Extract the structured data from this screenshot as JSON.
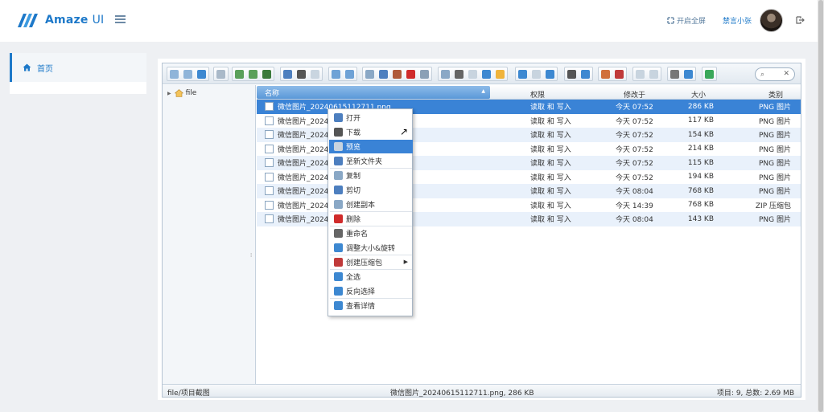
{
  "app": {
    "name": "Amaze",
    "name_suffix": "UI"
  },
  "header": {
    "fullscreen_label": "开启全屏",
    "username": "禁言小张"
  },
  "sidebar": {
    "items": [
      {
        "label": "首页"
      }
    ]
  },
  "filemanager": {
    "tree_root": "file",
    "columns": {
      "name": "名称",
      "perm": "权限",
      "modified": "修改于",
      "size": "大小",
      "kind": "类别"
    },
    "files": [
      {
        "name": "微信图片_20240615112711.png",
        "perm": "读取 和 写入",
        "modified": "今天 07:52",
        "size": "286 KB",
        "kind": "PNG 图片"
      },
      {
        "name": "微信图片_2024",
        "perm": "读取 和 写入",
        "modified": "今天 07:52",
        "size": "117 KB",
        "kind": "PNG 图片"
      },
      {
        "name": "微信图片_2024",
        "perm": "读取 和 写入",
        "modified": "今天 07:52",
        "size": "154 KB",
        "kind": "PNG 图片"
      },
      {
        "name": "微信图片_2024",
        "perm": "读取 和 写入",
        "modified": "今天 07:52",
        "size": "214 KB",
        "kind": "PNG 图片"
      },
      {
        "name": "微信图片_2024",
        "perm": "读取 和 写入",
        "modified": "今天 07:52",
        "size": "115 KB",
        "kind": "PNG 图片"
      },
      {
        "name": "微信图片_2024",
        "perm": "读取 和 写入",
        "modified": "今天 07:52",
        "size": "194 KB",
        "kind": "PNG 图片"
      },
      {
        "name": "微信图片_2024",
        "perm": "读取 和 写入",
        "modified": "今天 08:04",
        "size": "768 KB",
        "kind": "PNG 图片"
      },
      {
        "name": "微信图片_2024",
        "perm": "读取 和 写入",
        "modified": "今天 14:39",
        "size": "768 KB",
        "kind": "ZIP 压缩包"
      },
      {
        "name": "微信图片_2024",
        "perm": "读取 和 写入",
        "modified": "今天 08:04",
        "size": "143 KB",
        "kind": "PNG 图片"
      }
    ],
    "status": {
      "path": "file/项目截图",
      "selection": "微信图片_20240615112711.png, 286 KB",
      "summary": "项目: 9, 总数: 2.69 MB"
    }
  },
  "context_menu": {
    "items": [
      {
        "label": "打开"
      },
      {
        "label": "下载"
      },
      {
        "label": "预览"
      },
      {
        "label": "至新文件夹"
      },
      {
        "label": "复制"
      },
      {
        "label": "剪切"
      },
      {
        "label": "创建副本"
      },
      {
        "label": "删除"
      },
      {
        "label": "重命名"
      },
      {
        "label": "调整大小&旋转"
      },
      {
        "label": "创建压缩包"
      },
      {
        "label": "全选"
      },
      {
        "label": "反向选择"
      },
      {
        "label": "查看详情"
      }
    ]
  },
  "colors": {
    "accent": "#1e79c9",
    "selection": "#3a83d6",
    "row_alt": "#e9f1fb"
  }
}
